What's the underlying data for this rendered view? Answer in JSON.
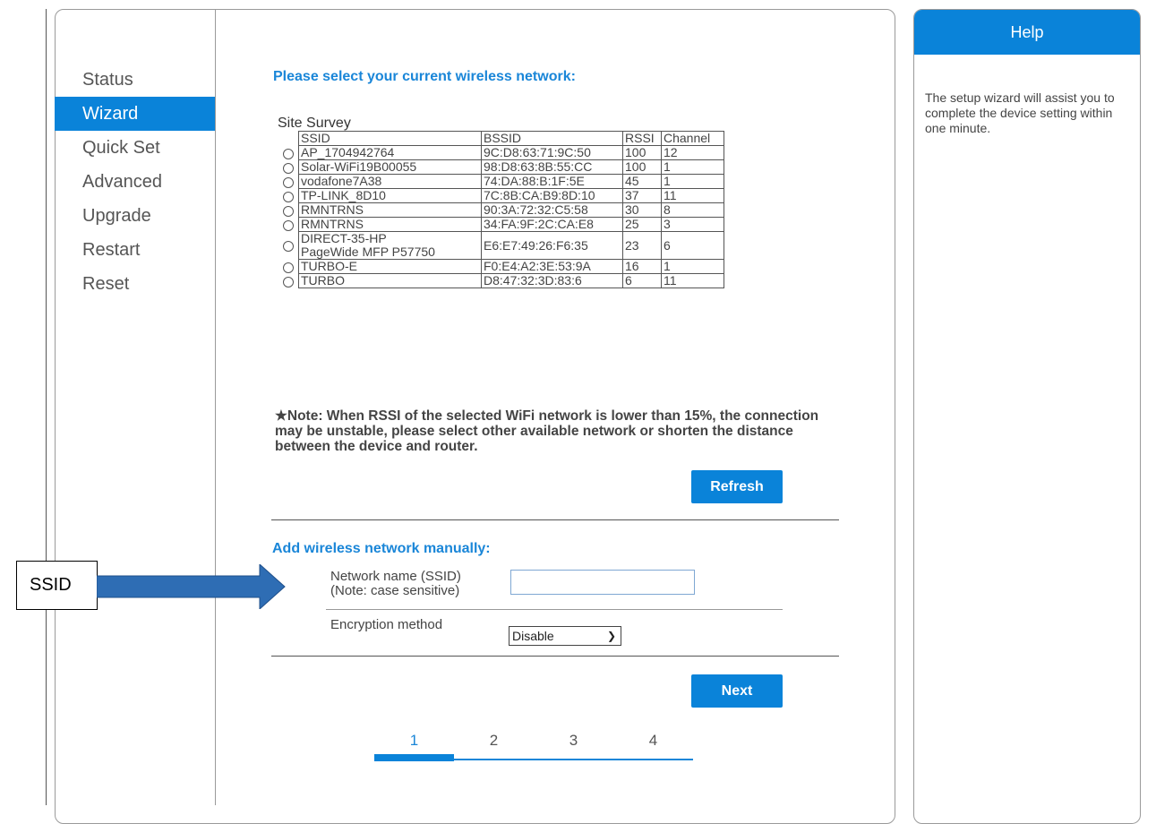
{
  "nav": {
    "items": [
      {
        "label": "Status",
        "active": false
      },
      {
        "label": "Wizard",
        "active": true
      },
      {
        "label": "Quick Set",
        "active": false
      },
      {
        "label": "Advanced",
        "active": false
      },
      {
        "label": "Upgrade",
        "active": false
      },
      {
        "label": "Restart",
        "active": false
      },
      {
        "label": "Reset",
        "active": false
      }
    ]
  },
  "main": {
    "title": "Please select your current wireless network:",
    "survey_caption": "Site Survey",
    "columns": [
      "SSID",
      "BSSID",
      "RSSI",
      "Channel"
    ],
    "networks": [
      {
        "ssid": "AP_1704942764",
        "bssid": "9C:D8:63:71:9C:50",
        "rssi": "100",
        "channel": "12"
      },
      {
        "ssid": "Solar-WiFi19B00055",
        "bssid": "98:D8:63:8B:55:CC",
        "rssi": "100",
        "channel": "1"
      },
      {
        "ssid": "vodafone7A38",
        "bssid": "74:DA:88:B:1F:5E",
        "rssi": "45",
        "channel": "1"
      },
      {
        "ssid": "TP-LINK_8D10",
        "bssid": "7C:8B:CA:B9:8D:10",
        "rssi": "37",
        "channel": "11"
      },
      {
        "ssid": "RMNTRNS",
        "bssid": "90:3A:72:32:C5:58",
        "rssi": "30",
        "channel": "8"
      },
      {
        "ssid": "RMNTRNS",
        "bssid": "34:FA:9F:2C:CA:E8",
        "rssi": "25",
        "channel": "3"
      },
      {
        "ssid": "DIRECT-35-HP PageWide MFP P57750",
        "bssid": "E6:E7:49:26:F6:35",
        "rssi": "23",
        "channel": "6"
      },
      {
        "ssid": "TURBO-E",
        "bssid": "F0:E4:A2:3E:53:9A",
        "rssi": "16",
        "channel": "1"
      },
      {
        "ssid": "TURBO",
        "bssid": "D8:47:32:3D:83:6",
        "rssi": "6",
        "channel": "11"
      }
    ],
    "note": "★Note: When RSSI of the selected WiFi network is lower than 15%, the connection may be unstable, please select other available network or shorten the distance between the device and router.",
    "refresh_label": "Refresh",
    "manual_title": "Add wireless network manually:",
    "ssid_label_line1": "Network name (SSID)",
    "ssid_label_line2": "(Note: case sensitive)",
    "ssid_value": "",
    "encryption_label": "Encryption method",
    "encryption_selected": "Disable",
    "next_label": "Next",
    "steps": [
      "1",
      "2",
      "3",
      "4"
    ],
    "current_step": 1
  },
  "help": {
    "title": "Help",
    "text": "The setup wizard will assist you to complete the device setting within one minute."
  },
  "annotation": {
    "label": "SSID"
  },
  "colors": {
    "accent": "#0a83d9",
    "title_blue": "#1a86d8",
    "arrow": "#2e6db4"
  }
}
